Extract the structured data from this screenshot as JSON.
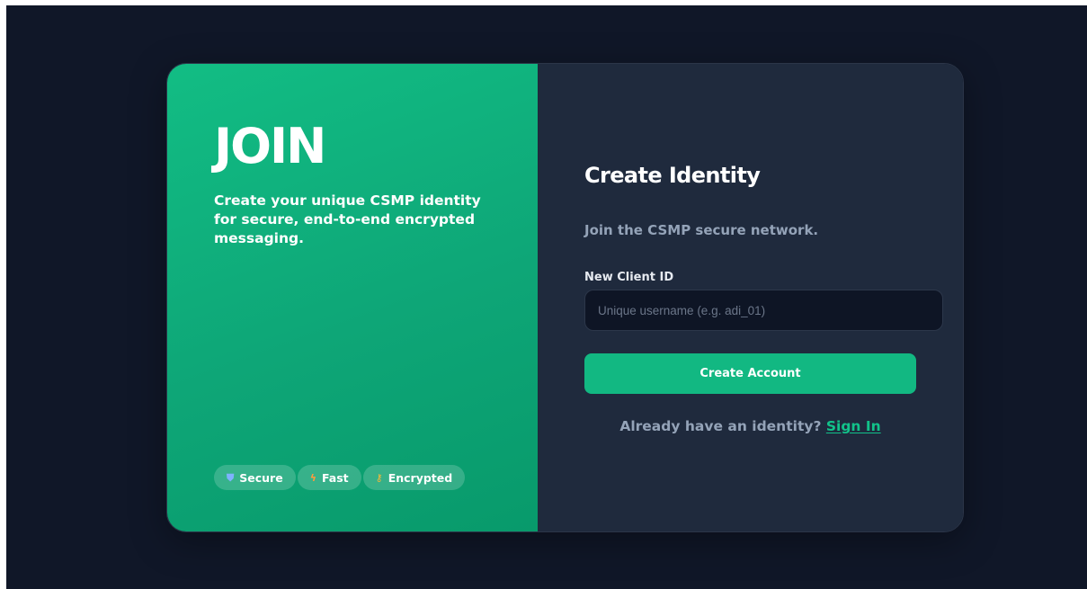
{
  "hero": {
    "title": "JOIN",
    "description": "Create your unique CSMP identity for secure, end-to-end encrypted messaging.",
    "badges": [
      {
        "label": "Secure",
        "icon": "shield-icon",
        "glyph": "⛊"
      },
      {
        "label": "Fast",
        "icon": "lightning-icon",
        "glyph": "ϟ"
      },
      {
        "label": "Encrypted",
        "icon": "key-icon",
        "glyph": "⚷"
      }
    ]
  },
  "form": {
    "title": "Create Identity",
    "subtitle": "Join the CSMP secure network.",
    "client_id_label": "New Client ID",
    "client_id_placeholder": "Unique username (e.g. adi_01)",
    "client_id_value": "",
    "submit_label": "Create Account",
    "signin_prompt": "Already have an identity?",
    "signin_link": "Sign In"
  },
  "colors": {
    "background": "#101728",
    "accent": "#12b882",
    "panel": "#1f2a3d",
    "muted_text": "#94a3b8"
  }
}
